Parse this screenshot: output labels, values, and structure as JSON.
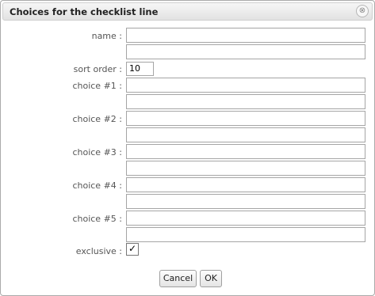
{
  "dialog": {
    "title": "Choices for the checklist line",
    "close_glyph": "⊗"
  },
  "fields": {
    "name_label": "name :",
    "sort_order_label": "sort order :",
    "sort_order_value": "10",
    "choice1_label": "choice #1 :",
    "choice2_label": "choice #2 :",
    "choice3_label": "choice #3 :",
    "choice4_label": "choice #4 :",
    "choice5_label": "choice #5 :",
    "exclusive_label": "exclusive :",
    "exclusive_checked": true,
    "check_glyph": "✓"
  },
  "buttons": {
    "cancel": "Cancel",
    "ok": "OK"
  }
}
